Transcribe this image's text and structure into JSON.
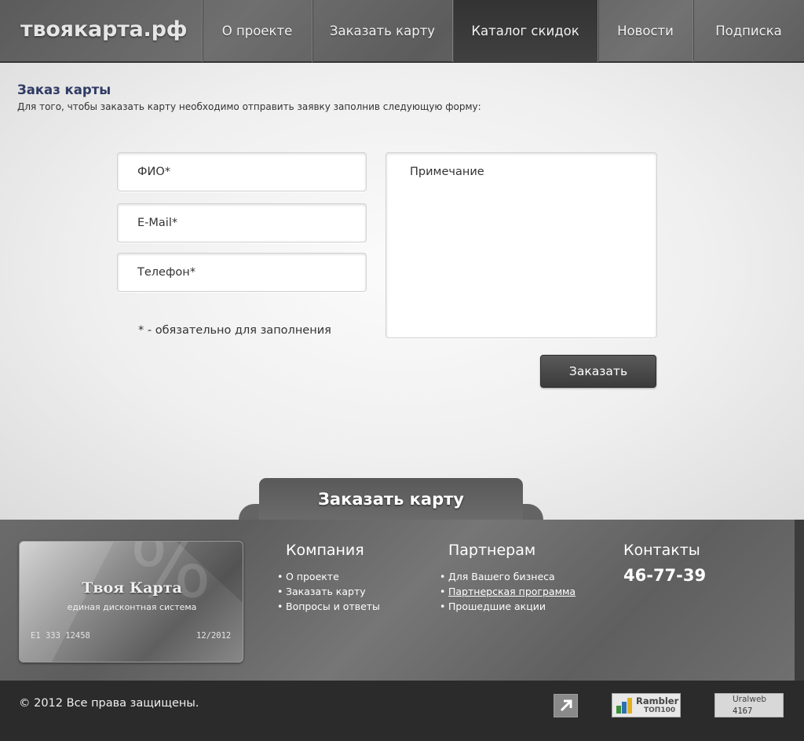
{
  "header": {
    "logo": "твоякарта.рф",
    "nav": [
      {
        "label": "О проекте"
      },
      {
        "label": "Заказать карту"
      },
      {
        "label": "Каталог скидок",
        "active": true
      },
      {
        "label": "Новости"
      },
      {
        "label": "Подписка"
      }
    ]
  },
  "main": {
    "title": "Заказ карты",
    "description": "Для того, чтобы заказать карту необходимо отправить заявку заполнив следующую форму:",
    "form": {
      "name_placeholder": "ФИО*",
      "email_placeholder": "E-Mail*",
      "phone_placeholder": "Телефон*",
      "note_placeholder": "Примечание",
      "required_note": "* - обязательно для заполнения",
      "submit_label": "Заказать"
    },
    "order_tab": "Заказать карту"
  },
  "footer": {
    "card": {
      "title": "Твоя Карта",
      "subtitle": "единая дисконтная система",
      "number": "E1 333 12458",
      "expiry": "12/2012"
    },
    "company": {
      "heading": "Компания",
      "links": [
        "О проекте",
        "Заказать карту",
        "Вопросы и ответы"
      ]
    },
    "partners": {
      "heading": "Партнерам",
      "links": [
        "Для Вашего бизнеса",
        "Партнерская программа",
        "Прошедшие акции"
      ]
    },
    "contacts": {
      "heading": "Контакты",
      "phone": "46-77-39"
    }
  },
  "bottom": {
    "copyright": "© 2012 Все права защищены.",
    "rambler_line1": "Rambler",
    "rambler_line2": "ТОП100",
    "uralweb_line1": "Uralweb",
    "uralweb_line2": "4167"
  },
  "colors": {
    "title": "#2e3a63",
    "header_bg": "#646464",
    "active_nav": "#383838",
    "button": "#4a4a4a"
  }
}
